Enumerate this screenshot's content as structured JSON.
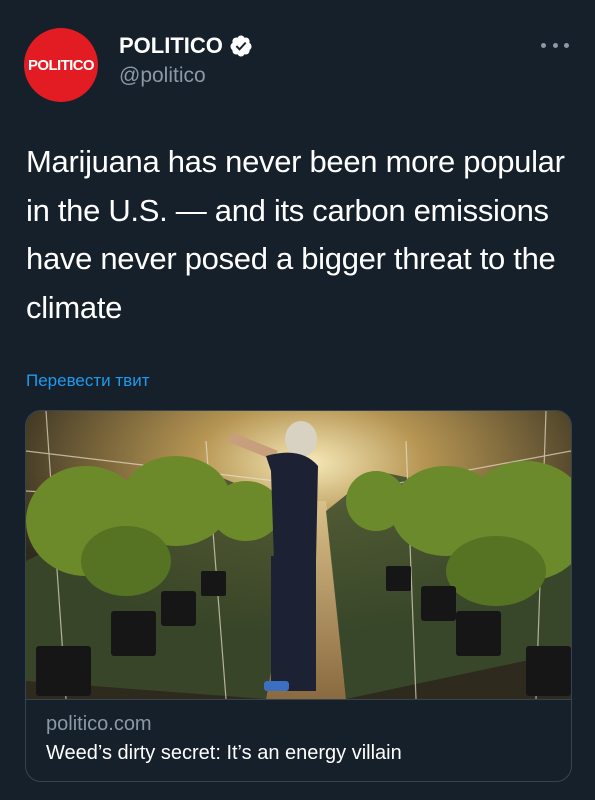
{
  "author": {
    "avatar_text": "POLITICO",
    "display_name": "POLITICO",
    "handle": "@politico",
    "verified": true,
    "avatar_color": "#e31c24"
  },
  "tweet": {
    "text": "Marijuana has never been more popular in the U.S. — and its carbon emissions have never posed a bigger threat to the climate",
    "translate_label": "Перевести твит"
  },
  "card": {
    "image_icon": "greenhouse-photo",
    "domain": "politico.com",
    "title": "Weed’s dirty secret: It’s an energy villain"
  },
  "icons": {
    "more": "more-icon",
    "verified": "verified-badge-icon"
  },
  "colors": {
    "background": "#15202b",
    "link": "#1d9bf0",
    "secondary_text": "#8b98a5",
    "border": "#38444d"
  }
}
